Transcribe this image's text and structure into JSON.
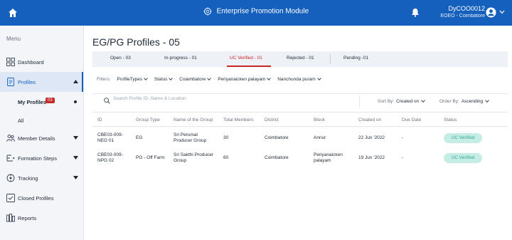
{
  "header": {
    "title": "Enterprise Promotion Module",
    "user_id": "DyCOO0012",
    "user_role": "EOEO - Coimbatore",
    "colors": {
      "bar": "#1560bd"
    }
  },
  "sidebar": {
    "menu_label": "Menu",
    "items": [
      {
        "label": "Dashboard",
        "icon": "dashboard-icon"
      },
      {
        "label": "Profiles",
        "icon": "profiles-icon"
      },
      {
        "label": "My Profiles",
        "badge": "03"
      },
      {
        "label": "All"
      },
      {
        "label": "Member Details",
        "icon": "members-icon"
      },
      {
        "label": "Formation Steps",
        "icon": "formation-steps-icon"
      },
      {
        "label": "Tracking",
        "icon": "tracking-icon"
      },
      {
        "label": "Closed Profiles",
        "icon": "closed-profiles-icon"
      },
      {
        "label": "Reports",
        "icon": "reports-icon"
      }
    ]
  },
  "main": {
    "title": "EG/PG Profiles - 05",
    "tabs": [
      {
        "label": "Open - 03"
      },
      {
        "label": "In-progress - 01"
      },
      {
        "label": "UC Verified - 01"
      },
      {
        "label": "Rejected - 01"
      },
      {
        "label": "Pending -01"
      }
    ],
    "filters": {
      "label": "Filters:",
      "items": [
        "ProfileTypes",
        "Status",
        "Coiambatore",
        "Periyanaicken palayam",
        "Nanchunda puram"
      ]
    },
    "search": {
      "placeholder": "Search Profile ID, Name & Location"
    },
    "sort": {
      "label": "Sort By:",
      "value": "Created on"
    },
    "order": {
      "label": "Order By:",
      "value": "Ascending"
    },
    "table": {
      "columns": [
        "ID",
        "Group Type",
        "Name of the Group",
        "Total Members",
        "District",
        "Block",
        "Created on",
        "Due Date",
        "Status"
      ],
      "rows": [
        {
          "id_line1": "CBE03-009-",
          "id_line2": "NEG 01",
          "group_type": "EG",
          "name_line1": "Sri Perumal",
          "name_line2": "Producer Group",
          "members": "30",
          "district": "Coimbatore",
          "block_line1": "Annur",
          "block_line2": "",
          "created": "22 Jun '2022",
          "due": "-",
          "status": "UC Verified"
        },
        {
          "id_line1": "CBE03-009-",
          "id_line2": "NPG 02",
          "group_type": "PG - Off Farm",
          "name_line1": "Sri Sakthi Producer",
          "name_line2": "Group",
          "members": "60",
          "district": "Coimbatore",
          "block_line1": "Periyanaicken",
          "block_line2": "palayam",
          "created": "19 Jun '2022",
          "due": "-",
          "status": "UC Verified"
        }
      ]
    }
  }
}
